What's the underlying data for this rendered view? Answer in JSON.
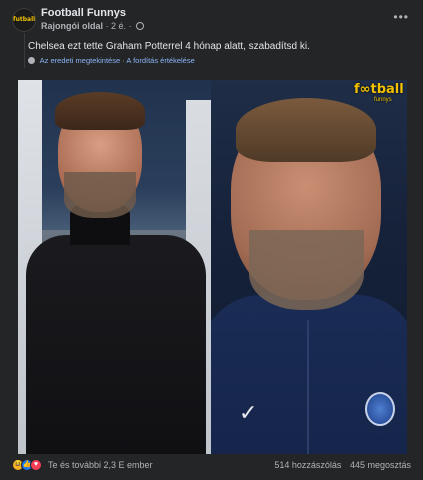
{
  "post": {
    "page_name": "Football Funnys",
    "avatar_text": "futball",
    "role": "Rajongói oldal",
    "dot": "·",
    "time": "2 é.",
    "more_label": "•••",
    "text": "Chelsea ezt tette Graham Potterrel 4 hónap alatt, szabadítsd ki.",
    "translate": {
      "original": "Az eredeti megtekintése",
      "sep": "·",
      "rate": "A fordítás értékelése"
    }
  },
  "media": {
    "watermark": "f∞tball",
    "watermark_sub": "funnys"
  },
  "footer": {
    "reactions_text": "Te és további 2,3 E ember",
    "comments": "514 hozzászólás",
    "shares": "445 megosztás"
  },
  "icons": {
    "reaction_1": "haha-emoji-icon",
    "reaction_2": "like-icon",
    "reaction_3": "love-icon"
  },
  "colors": {
    "background": "#242526",
    "link": "#8ab4f8",
    "brand": "#f2c200"
  }
}
